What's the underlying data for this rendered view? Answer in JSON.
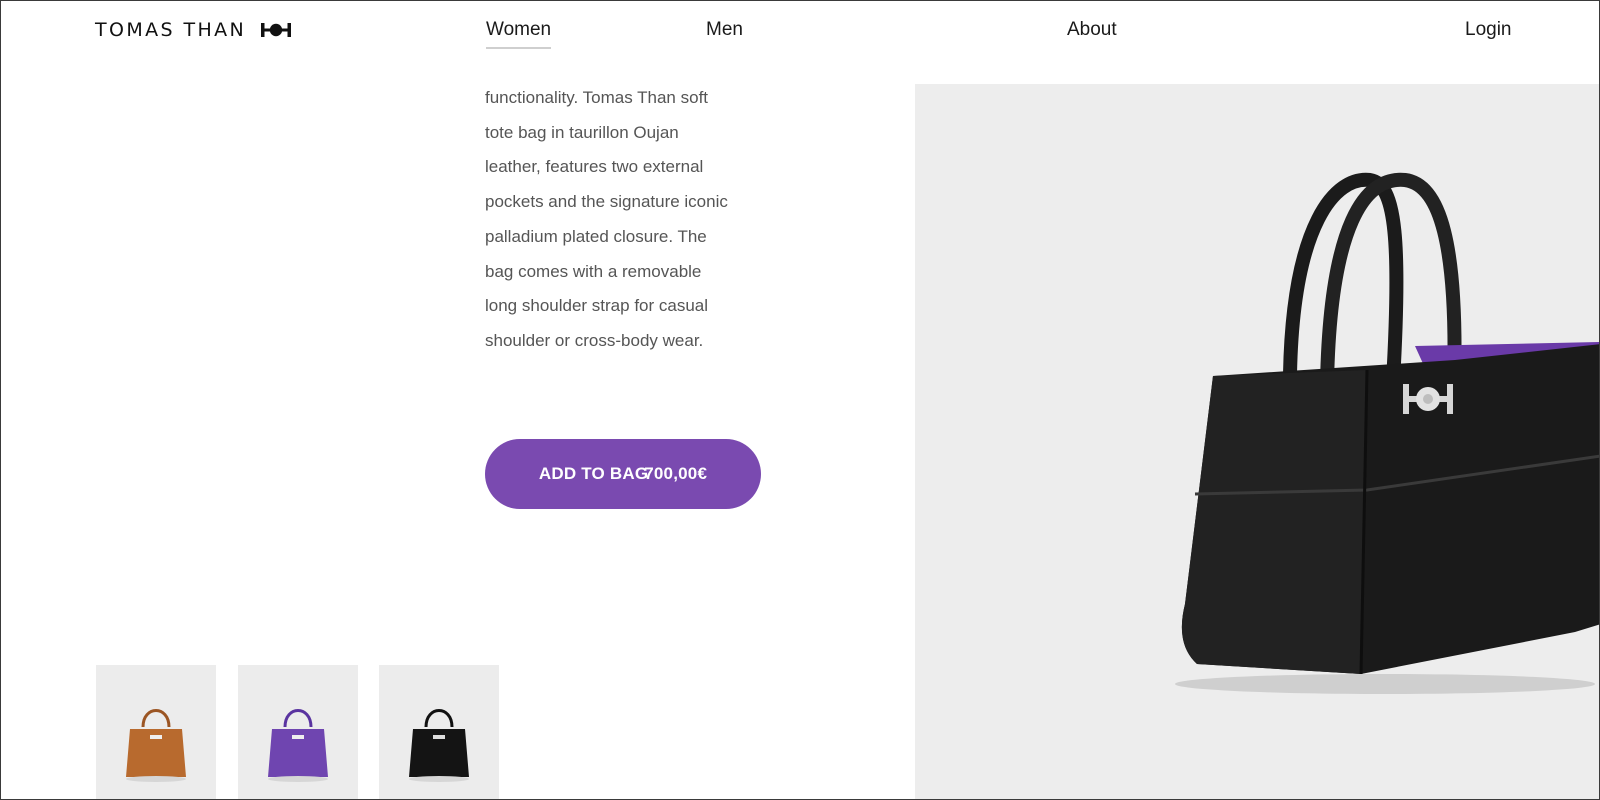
{
  "header": {
    "brand": "TOMAS THAN",
    "logo_icon": "tomas-than-monogram-icon",
    "nav": {
      "women": "Women",
      "men": "Men",
      "about": "About",
      "login": "Login"
    },
    "active_nav": "Women"
  },
  "product": {
    "description_lines": [
      "functionality. Tomas Than soft",
      "tote bag in taurillon Oujan",
      "leather, features two external",
      "pockets and the signature iconic",
      "palladium plated closure. The",
      "bag comes with a removable",
      "long shoulder strap for casual",
      "shoulder or cross-body wear."
    ],
    "add_to_bag_label": "ADD TO BAG",
    "price": "700,00€",
    "main_image_icon": "black-tote-bag-image",
    "selected_color": "black"
  },
  "thumbnails": [
    {
      "color_name": "tan",
      "color": "#b86a2e",
      "icon": "tan-tote-bag-thumbnail"
    },
    {
      "color_name": "purple",
      "color": "#6f45b0",
      "icon": "purple-tote-bag-thumbnail"
    },
    {
      "color_name": "black",
      "color": "#141414",
      "icon": "black-tote-bag-thumbnail"
    }
  ],
  "colors": {
    "accent": "#7a4ab0",
    "panel_bg": "#ededed",
    "text_muted": "#555555"
  }
}
